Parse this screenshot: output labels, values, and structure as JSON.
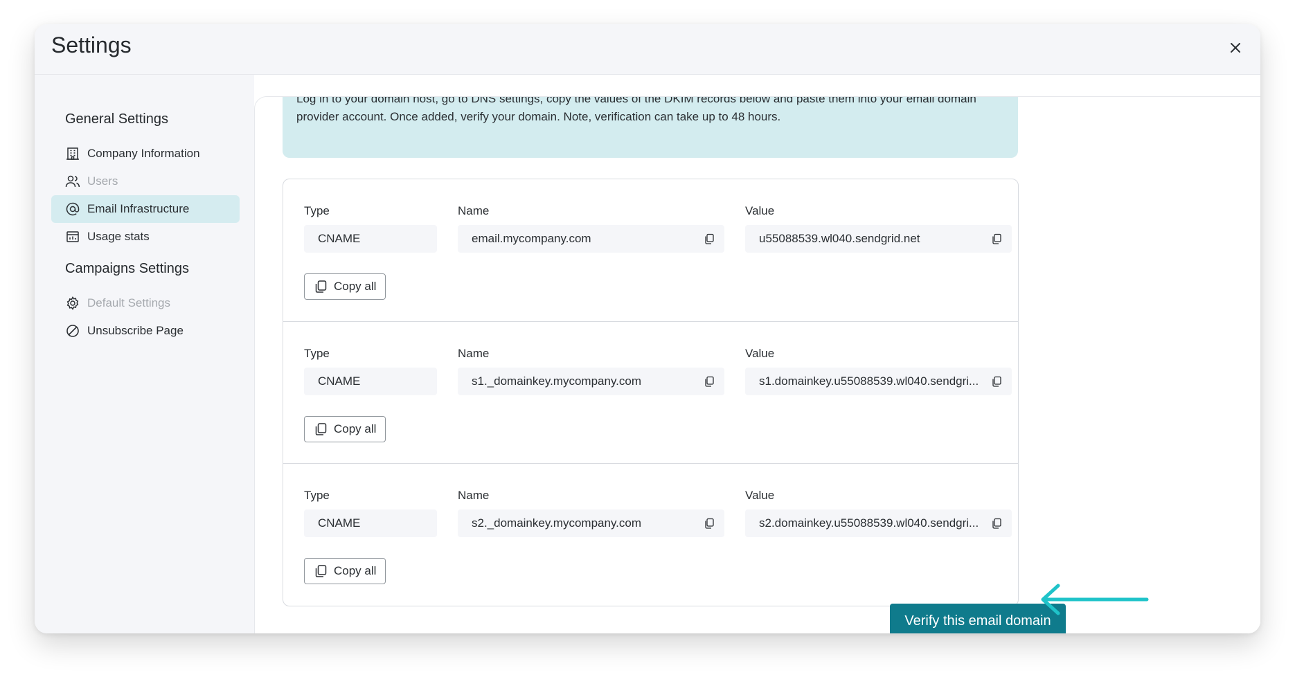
{
  "window": {
    "title": "Settings"
  },
  "sidebar": {
    "general_heading": "General Settings",
    "general_items": [
      {
        "label": "Company Information",
        "icon": "building-icon",
        "state": "normal"
      },
      {
        "label": "Users",
        "icon": "users-icon",
        "state": "disabled"
      },
      {
        "label": "Email Infrastructure",
        "icon": "at-sign-icon",
        "state": "active"
      },
      {
        "label": "Usage stats",
        "icon": "stats-icon",
        "state": "normal"
      }
    ],
    "campaigns_heading": "Campaigns Settings",
    "campaigns_items": [
      {
        "label": "Default Settings",
        "icon": "gear-icon",
        "state": "disabled"
      },
      {
        "label": "Unsubscribe Page",
        "icon": "block-icon",
        "state": "normal"
      }
    ]
  },
  "notice": {
    "text": "Log in to your domain host, go to DNS settings, copy the values of the DKIM records below and paste them into your email domain provider account. Once added, verify your domain. Note, verification can take up to 48 hours."
  },
  "records": [
    {
      "type_label": "Type",
      "name_label": "Name",
      "value_label": "Value",
      "type": "CNAME",
      "name": "email.mycompany.com",
      "value": "u55088539.wl040.sendgrid.net",
      "copy_all": "Copy all"
    },
    {
      "type_label": "Type",
      "name_label": "Name",
      "value_label": "Value",
      "type": "CNAME",
      "name": "s1._domainkey.mycompany.com",
      "value": "s1.domainkey.u55088539.wl040.sendgri...",
      "copy_all": "Copy all"
    },
    {
      "type_label": "Type",
      "name_label": "Name",
      "value_label": "Value",
      "type": "CNAME",
      "name": "s2._domainkey.mycompany.com",
      "value": "s2.domainkey.u55088539.wl040.sendgri...",
      "copy_all": "Copy all"
    }
  ],
  "verify_button": "Verify this email domain",
  "colors": {
    "accent": "#0f7b8c",
    "active_bg": "#d5ecf0",
    "notice_bg": "#d3ecef",
    "arrow": "#1fc3c9"
  }
}
